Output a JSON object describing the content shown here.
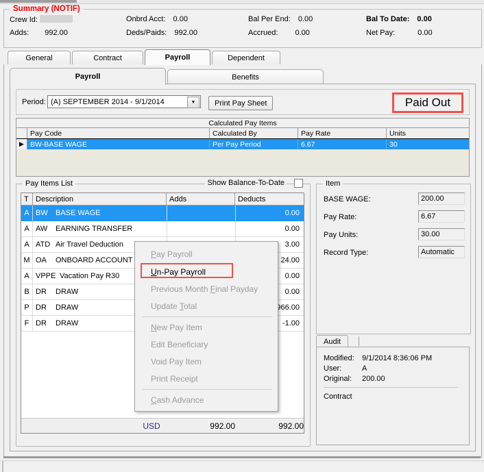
{
  "summary": {
    "legend": "Summary (NOTIF)",
    "fields": [
      {
        "label": "Crew Id:",
        "value": "",
        "redacted": true
      },
      {
        "label": "Onbrd Acct:",
        "value": "0.00"
      },
      {
        "label": "Bal Per End:",
        "value": "0.00"
      },
      {
        "label": "Bal To Date:",
        "value": "0.00",
        "bold": true
      },
      {
        "label": "Adds:",
        "value": "992.00"
      },
      {
        "label": "Deds/Paids:",
        "value": "992.00"
      },
      {
        "label": "Accrued:",
        "value": "0.00"
      },
      {
        "label": "Net Pay:",
        "value": "0.00"
      }
    ]
  },
  "outer_tabs": [
    {
      "label": "General",
      "active": false
    },
    {
      "label": "Contract",
      "active": false
    },
    {
      "label": "Payroll",
      "active": true
    },
    {
      "label": "Dependent",
      "active": false
    }
  ],
  "inner_tabs": [
    {
      "label": "Payroll",
      "active": true
    },
    {
      "label": "Benefits",
      "active": false
    }
  ],
  "period": {
    "label": "Period:",
    "selected": "(A) SEPTEMBER 2014 - 9/1/2014",
    "arrow": "▼",
    "print_button": "Print Pay Sheet",
    "status_badge": "Paid Out",
    "badge_color": "#f4504a"
  },
  "calculated_pay_items": {
    "caption": "Calculated Pay Items",
    "columns": [
      "Pay Code",
      "Calculated By",
      "Pay Rate",
      "Units"
    ],
    "rows": [
      {
        "marker": "▶",
        "pay_code": "BW-BASE WAGE",
        "calculated_by": "Per Pay Period",
        "pay_rate": "6.67",
        "units": "30",
        "selected": true
      }
    ],
    "selection_color": "#2196f3"
  },
  "pay_items_list": {
    "legend": "Pay Items List",
    "show_balance_label": "Show Balance-To-Date",
    "show_balance_checked": false,
    "columns": [
      "T",
      "Description",
      "Adds",
      "Deducts"
    ],
    "rows": [
      {
        "t": "A",
        "code": "BW",
        "desc": "BASE WAGE",
        "adds": "",
        "deducts": "0.00",
        "selected": true
      },
      {
        "t": "A",
        "code": "AW",
        "desc": "EARNING TRANSFER",
        "adds": "",
        "deducts": "0.00",
        "selected": false
      },
      {
        "t": "A",
        "code": "ATD",
        "desc": "Air Travel Deduction",
        "adds": "",
        "deducts": "3.00",
        "selected": false
      },
      {
        "t": "M",
        "code": "OA",
        "desc": "ONBOARD ACCOUNT SETT",
        "adds": "",
        "deducts": "24.00",
        "selected": false
      },
      {
        "t": "A",
        "code": "VPPER",
        "desc": "Vacation Pay R30",
        "adds": "",
        "deducts": "0.00",
        "selected": false
      },
      {
        "t": "B",
        "code": "DR",
        "desc": "DRAW",
        "adds": "",
        "deducts": "0.00",
        "selected": false
      },
      {
        "t": "P",
        "code": "DR",
        "desc": "DRAW",
        "adds": "",
        "deducts": "966.00",
        "selected": false
      },
      {
        "t": "F",
        "code": "DR",
        "desc": "DRAW",
        "adds": "",
        "deducts": "-1.00",
        "selected": false
      }
    ],
    "footer": {
      "currency": "USD",
      "adds_total": "992.00",
      "deducts_total": "992.00"
    }
  },
  "context_menu": {
    "items": [
      {
        "label": "Pay Payroll",
        "mnemonic": "P",
        "enabled": false,
        "highlighted": false
      },
      {
        "label": "Un-Pay Payroll",
        "mnemonic": "U",
        "enabled": true,
        "highlighted": true
      },
      {
        "label": "Previous Month Final Payday",
        "mnemonic": "F",
        "enabled": false,
        "highlighted": false
      },
      {
        "label": "Update Total",
        "mnemonic": "T",
        "enabled": false,
        "highlighted": false
      },
      {
        "separator": true
      },
      {
        "label": "New Pay Item",
        "mnemonic": "N",
        "enabled": false,
        "highlighted": false
      },
      {
        "label": "Edit Beneficiary",
        "enabled": false,
        "highlighted": false
      },
      {
        "label": "Void Pay Item",
        "enabled": false,
        "highlighted": false
      },
      {
        "label": "Print Receipt",
        "enabled": false,
        "highlighted": false
      },
      {
        "separator": true
      },
      {
        "label": "Cash Advance",
        "mnemonic": "C",
        "enabled": false,
        "highlighted": false
      }
    ]
  },
  "item_panel": {
    "legend": "Item",
    "fields": [
      {
        "label": "BASE WAGE:",
        "value": "200.00"
      },
      {
        "label": "Pay Rate:",
        "value": "6.67"
      },
      {
        "label": "Pay Units:",
        "value": "30.00"
      },
      {
        "label": "Record Type:",
        "value": "Automatic"
      }
    ]
  },
  "audit": {
    "tab_label": "Audit",
    "rows": [
      {
        "key": "Modified:",
        "value": "9/1/2014 8:36:06 PM"
      },
      {
        "key": "User:",
        "value": "A"
      },
      {
        "key": "Original:",
        "value": "200.00"
      }
    ],
    "footer": "Contract"
  }
}
